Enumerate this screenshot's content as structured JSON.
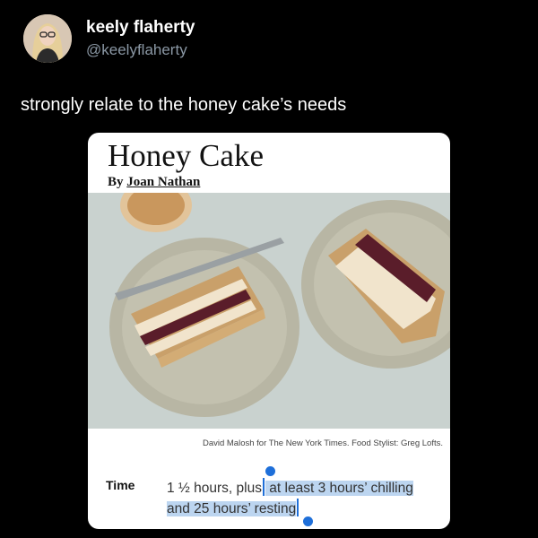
{
  "tweet": {
    "display_name": "keely flaherty",
    "handle": "@keelyflaherty",
    "text": "strongly relate to the honey cake’s needs"
  },
  "recipe_card": {
    "title": "Honey Cake",
    "byline_prefix": "By ",
    "author": "Joan Nathan",
    "photo_caption": "David Malosh for The New York Times. Food Stylist: Greg Lofts.",
    "time_label": "Time",
    "time_plain": "1 ½ hours, plus",
    "time_selected_line1": " at least 3 hours’ chilling",
    "time_selected_line2": "and 25 hours’ resting"
  },
  "colors": {
    "background": "#000000",
    "handle_gray": "#8b98a5",
    "selection_highlight": "#bcd5f0",
    "selection_handle": "#1e6fd9"
  },
  "icons": [
    "avatar",
    "text-selection-handle"
  ]
}
